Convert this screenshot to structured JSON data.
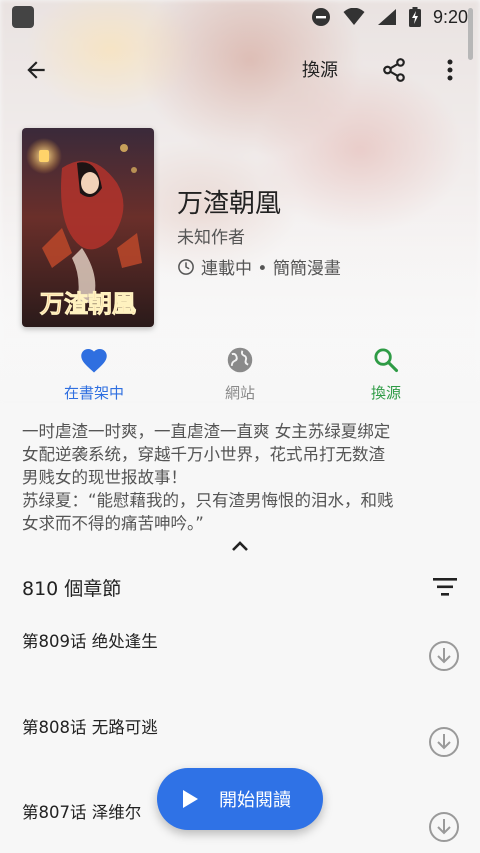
{
  "status_bar": {
    "time": "9:20"
  },
  "toolbar": {
    "source_label": "換源"
  },
  "book": {
    "title": "万渣朝凰",
    "author": "未知作者",
    "status": "連載中 • 簡簡漫畫",
    "cover_text": "万渣朝凰"
  },
  "actions": {
    "shelf_label": "在書架中",
    "web_label": "網站",
    "swap_label": "換源"
  },
  "description": {
    "line1": "一时虐渣一时爽，一直虐渣一直爽 女主苏绿夏绑定",
    "line2": "女配逆袭系统，穿越千万小世界，花式吊打无数渣",
    "line3": "男贱女的现世报故事！",
    "line4": "苏绿夏：“能慰藉我的，只有渣男悔恨的泪水，和贱",
    "line5": "女求而不得的痛苦呻吟。”"
  },
  "chapters": {
    "count_label": "810 個章節",
    "items": [
      {
        "title": "第809话 绝处逢生"
      },
      {
        "title": "第808话 无路可逃"
      },
      {
        "title": "第807话 泽维尔"
      }
    ]
  },
  "fab": {
    "label": "開始閱讀"
  },
  "colors": {
    "accent_blue": "#2f72e6",
    "shelf_blue": "#2f6fe0",
    "swap_green": "#2e9b45",
    "muted_grey": "#8a8a8a"
  }
}
